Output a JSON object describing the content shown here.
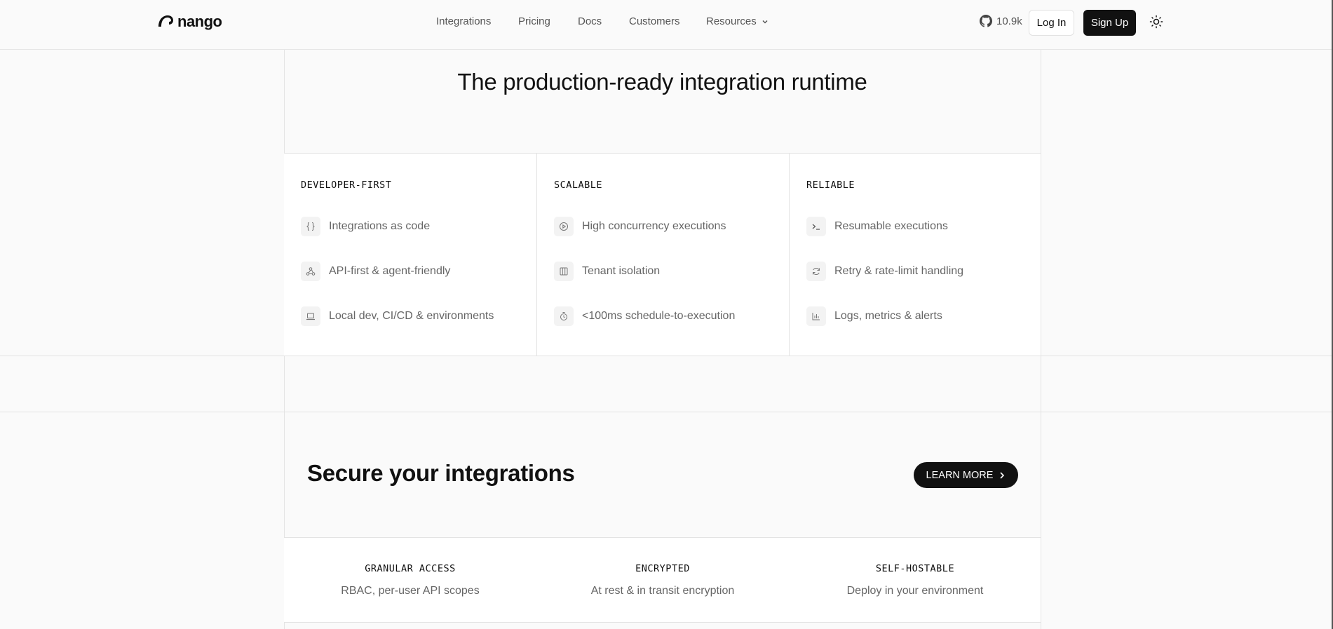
{
  "header": {
    "brand": "nango",
    "nav": [
      {
        "label": "Integrations"
      },
      {
        "label": "Pricing"
      },
      {
        "label": "Docs"
      },
      {
        "label": "Customers"
      },
      {
        "label": "Resources"
      }
    ],
    "github_stars": "10.9k",
    "login_label": "Log In",
    "signup_label": "Sign Up"
  },
  "runtime": {
    "title": "The production-ready integration runtime",
    "columns": [
      {
        "heading": "DEVELOPER-FIRST",
        "items": [
          {
            "icon": "braces-icon",
            "label": "Integrations as code"
          },
          {
            "icon": "webhook-icon",
            "label": "API-first & agent-friendly"
          },
          {
            "icon": "laptop-icon",
            "label": "Local dev, CI/CD & environments"
          }
        ]
      },
      {
        "heading": "SCALABLE",
        "items": [
          {
            "icon": "play-circle-icon",
            "label": "High concurrency executions"
          },
          {
            "icon": "columns-icon",
            "label": "Tenant isolation"
          },
          {
            "icon": "timer-icon",
            "label": "<100ms schedule-to-execution"
          }
        ]
      },
      {
        "heading": "RELIABLE",
        "items": [
          {
            "icon": "terminal-icon",
            "label": "Resumable executions"
          },
          {
            "icon": "refresh-icon",
            "label": "Retry & rate-limit handling"
          },
          {
            "icon": "bar-chart-icon",
            "label": "Logs, metrics & alerts"
          }
        ]
      }
    ]
  },
  "security": {
    "title": "Secure your integrations",
    "cta_label": "LEARN MORE",
    "cards": [
      {
        "heading": "GRANULAR ACCESS",
        "text": "RBAC, per-user API scopes"
      },
      {
        "heading": "ENCRYPTED",
        "text": "At rest & in transit encryption"
      },
      {
        "heading": "SELF-HOSTABLE",
        "text": "Deploy in your environment"
      }
    ]
  }
}
